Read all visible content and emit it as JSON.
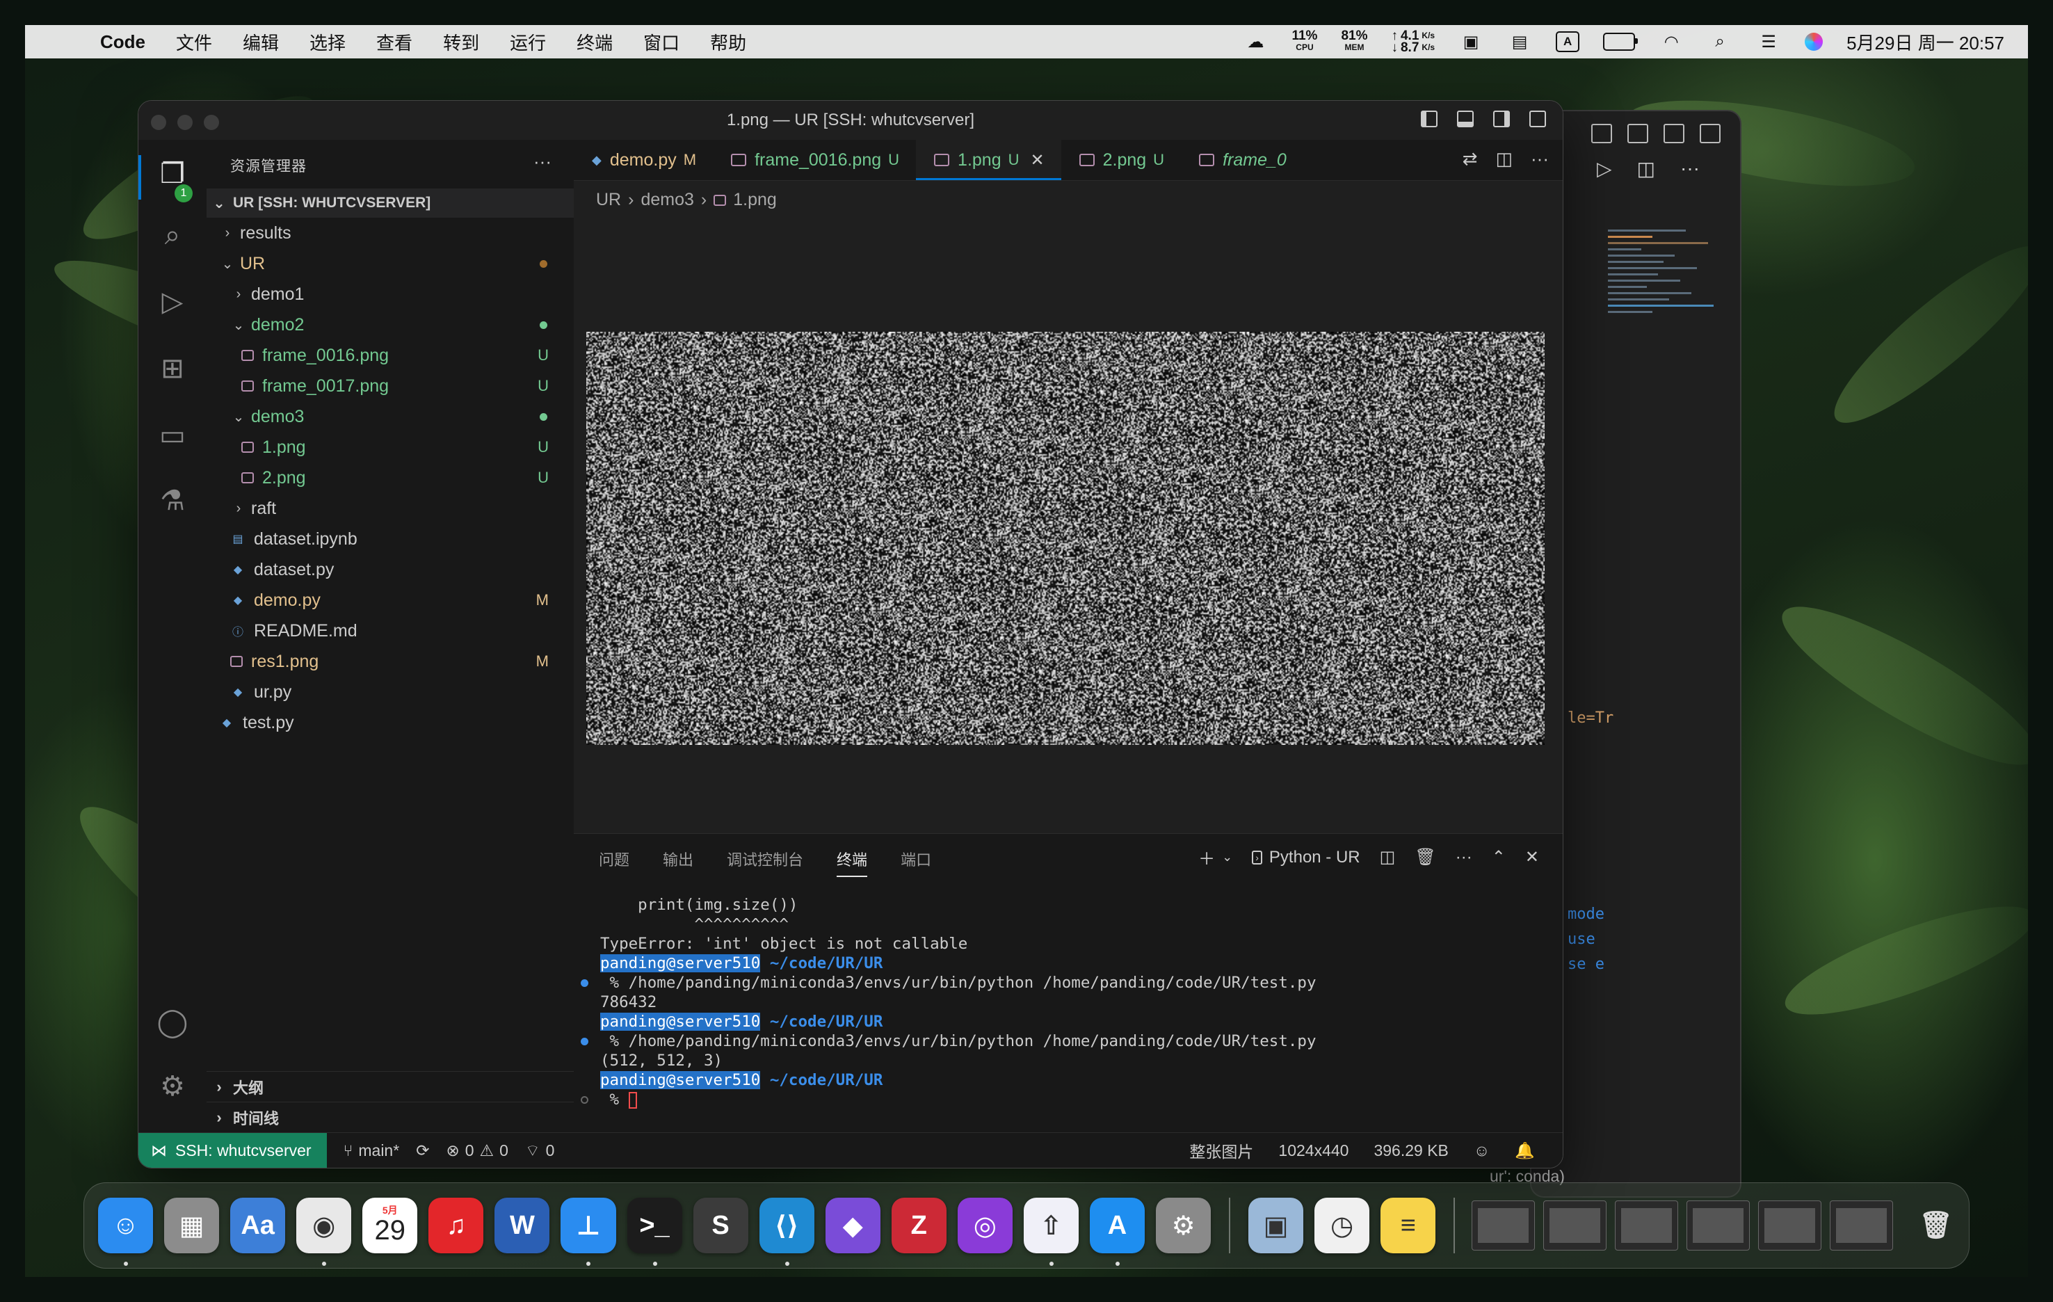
{
  "menubar": {
    "app_name": "Code",
    "items": [
      "文件",
      "编辑",
      "选择",
      "查看",
      "转到",
      "运行",
      "终端",
      "窗口",
      "帮助"
    ],
    "cpu": {
      "value": "11%",
      "label": "CPU"
    },
    "mem": {
      "value": "81%",
      "label": "MEM"
    },
    "net_up": "4.1",
    "net_down": "8.7",
    "net_unit": "K/s",
    "input_method": "A",
    "clock": "5月29日 周一 20:57"
  },
  "window": {
    "title": "1.png — UR [SSH: whutcvserver]"
  },
  "sidebar": {
    "header": "资源管理器",
    "more": "···",
    "root": "UR [SSH: WHUTCVSERVER]",
    "items": [
      {
        "label": "results",
        "kind": "folder",
        "depth": 1,
        "open": false
      },
      {
        "label": "UR",
        "kind": "folder",
        "depth": 1,
        "open": true,
        "color": "orange",
        "dot": "#a06c2c"
      },
      {
        "label": "demo1",
        "kind": "folder",
        "depth": 2,
        "open": false
      },
      {
        "label": "demo2",
        "kind": "folder",
        "depth": 2,
        "open": true,
        "color": "green",
        "dot": "#73c991"
      },
      {
        "label": "frame_0016.png",
        "kind": "image",
        "depth": 3,
        "color": "green",
        "status": "U"
      },
      {
        "label": "frame_0017.png",
        "kind": "image",
        "depth": 3,
        "color": "green",
        "status": "U"
      },
      {
        "label": "demo3",
        "kind": "folder",
        "depth": 2,
        "open": true,
        "color": "green",
        "dot": "#73c991"
      },
      {
        "label": "1.png",
        "kind": "image",
        "depth": 3,
        "color": "green",
        "status": "U"
      },
      {
        "label": "2.png",
        "kind": "image",
        "depth": 3,
        "color": "green",
        "status": "U"
      },
      {
        "label": "raft",
        "kind": "folder",
        "depth": 2,
        "open": false
      },
      {
        "label": "dataset.ipynb",
        "kind": "notebook",
        "depth": 2
      },
      {
        "label": "dataset.py",
        "kind": "python",
        "depth": 2
      },
      {
        "label": "demo.py",
        "kind": "python",
        "depth": 2,
        "color": "orange",
        "status": "M"
      },
      {
        "label": "README.md",
        "kind": "info",
        "depth": 2
      },
      {
        "label": "res1.png",
        "kind": "image",
        "depth": 2,
        "color": "orange",
        "status": "M"
      },
      {
        "label": "ur.py",
        "kind": "python",
        "depth": 2
      },
      {
        "label": "test.py",
        "kind": "python",
        "depth": 1
      }
    ],
    "outline": "大纲",
    "timeline": "时间线"
  },
  "tabs": [
    {
      "label": "demo.py",
      "status": "M",
      "kind": "python",
      "color": "orange"
    },
    {
      "label": "frame_0016.png",
      "status": "U",
      "kind": "image",
      "color": "green"
    },
    {
      "label": "1.png",
      "status": "U",
      "kind": "image",
      "color": "green",
      "active": true
    },
    {
      "label": "2.png",
      "status": "U",
      "kind": "image",
      "color": "green"
    },
    {
      "label": "frame_0",
      "status": "",
      "kind": "image",
      "color": "green"
    }
  ],
  "breadcrumb": [
    "UR",
    "demo3",
    "1.png"
  ],
  "panel": {
    "tabs": [
      "问题",
      "输出",
      "调试控制台",
      "终端",
      "端口"
    ],
    "active_tab": "终端",
    "shell_label": "Python - UR",
    "terminal": [
      {
        "type": "text",
        "text": "    print(img.size())"
      },
      {
        "type": "text",
        "text": "          ^^^^^^^^^^"
      },
      {
        "type": "text",
        "text": "TypeError: 'int' object is not callable"
      },
      {
        "type": "prompt",
        "user": "panding@server510",
        "path": "~/code/UR/UR"
      },
      {
        "type": "cmd",
        "text": " % /home/panding/miniconda3/envs/ur/bin/python /home/panding/code/UR/test.py",
        "mark": "filled"
      },
      {
        "type": "text",
        "text": "786432"
      },
      {
        "type": "prompt",
        "user": "panding@server510",
        "path": "~/code/UR/UR"
      },
      {
        "type": "cmd",
        "text": " % /home/panding/miniconda3/envs/ur/bin/python /home/panding/code/UR/test.py",
        "mark": "filled"
      },
      {
        "type": "text",
        "text": "(512, 512, 3)"
      },
      {
        "type": "prompt",
        "user": "panding@server510",
        "path": "~/code/UR/UR"
      },
      {
        "type": "input",
        "text": " % ",
        "mark": "empty"
      }
    ]
  },
  "statusbar": {
    "remote": "SSH: whutcvserver",
    "branch": "main*",
    "errors": "0",
    "warnings": "0",
    "ports": "0",
    "image_mode": "整张图片",
    "dimensions": "1024x440",
    "file_size": "396.29 KB"
  },
  "background_window": {
    "snippet": "le=Tr",
    "terminal_snippets": [
      "mode",
      "use",
      "se e"
    ],
    "status_snippet": "ur': conda)"
  },
  "dock": {
    "calendar_month": "5月",
    "calendar_day": "29",
    "apps": [
      {
        "name": "finder-icon",
        "color": "#2b8cf0",
        "glyph": "☺"
      },
      {
        "name": "launchpad-icon",
        "color": "#8c8c8c",
        "glyph": "▦"
      },
      {
        "name": "dictionary-icon",
        "color": "#3d7fd8",
        "glyph": "Aa"
      },
      {
        "name": "chrome-icon",
        "color": "#e8e8e8",
        "glyph": "◉"
      },
      {
        "name": "calendar-icon",
        "color": "#ffffff",
        "glyph": ""
      },
      {
        "name": "netease-music-icon",
        "color": "#e3262a",
        "glyph": "♫"
      },
      {
        "name": "word-icon",
        "color": "#2b5fb4",
        "glyph": "W"
      },
      {
        "name": "keynote-icon",
        "color": "#2a8cf0",
        "glyph": "⊥"
      },
      {
        "name": "terminal-icon",
        "color": "#1c1c1c",
        "glyph": ">_"
      },
      {
        "name": "sublime-icon",
        "color": "#3b3b3b",
        "glyph": "S"
      },
      {
        "name": "vscode-icon",
        "color": "#1f8ad2",
        "glyph": "⟨⟩"
      },
      {
        "name": "obsidian-icon",
        "color": "#7a4cd8",
        "glyph": "◆"
      },
      {
        "name": "zotero-icon",
        "color": "#cc2936",
        "glyph": "Z"
      },
      {
        "name": "chatbot-icon",
        "color": "#8a3bd8",
        "glyph": "◎"
      },
      {
        "name": "rocket-icon",
        "color": "#f0f0f8",
        "glyph": "⇧"
      },
      {
        "name": "app-store-icon",
        "color": "#1e8ef0",
        "glyph": "A"
      },
      {
        "name": "system-settings-icon",
        "color": "#8a8a8a",
        "glyph": "⚙"
      }
    ],
    "apps2": [
      {
        "name": "preview-icon",
        "color": "#9ab8d8",
        "glyph": "▣"
      },
      {
        "name": "clock-icon",
        "color": "#f0f0f0",
        "glyph": "◷"
      },
      {
        "name": "notes-icon",
        "color": "#f7d34a",
        "glyph": "≡"
      }
    ]
  },
  "colors": {
    "accent": "#0078d4",
    "git_untracked": "#73c991",
    "git_modified": "#e2c08d",
    "remote_bg": "#16825d"
  }
}
